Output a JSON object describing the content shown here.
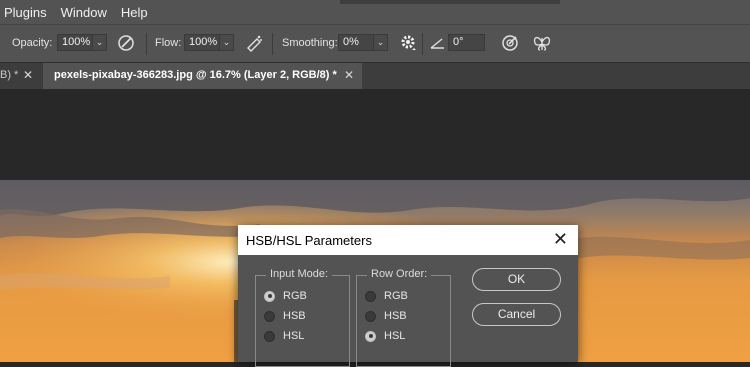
{
  "menubar": {
    "items": [
      "Plugins",
      "Window",
      "Help"
    ]
  },
  "options": {
    "opacity_label": "Opacity:",
    "opacity_value": "100%",
    "flow_label": "Flow:",
    "flow_value": "100%",
    "smoothing_label": "Smoothing:",
    "smoothing_value": "0%",
    "angle_value": "0°",
    "icons": [
      "pressure-opacity-icon",
      "airbrush-icon",
      "gear-icon",
      "angle-icon",
      "pressure-size-icon",
      "symmetry-butterfly-icon"
    ]
  },
  "tabs": {
    "inactive_label": "B) *",
    "active_label": "pexels-pixabay-366283.jpg @ 16.7% (Layer 2, RGB/8) *",
    "close_glyph": "✕"
  },
  "dialog": {
    "title": "HSB/HSL Parameters",
    "close_glyph": "✕",
    "input_mode": {
      "legend": "Input Mode:",
      "options": [
        "RGB",
        "HSB",
        "HSL"
      ],
      "selected": "RGB"
    },
    "row_order": {
      "legend": "Row Order:",
      "options": [
        "RGB",
        "HSB",
        "HSL"
      ],
      "selected": "HSL"
    },
    "ok_label": "OK",
    "cancel_label": "Cancel"
  }
}
